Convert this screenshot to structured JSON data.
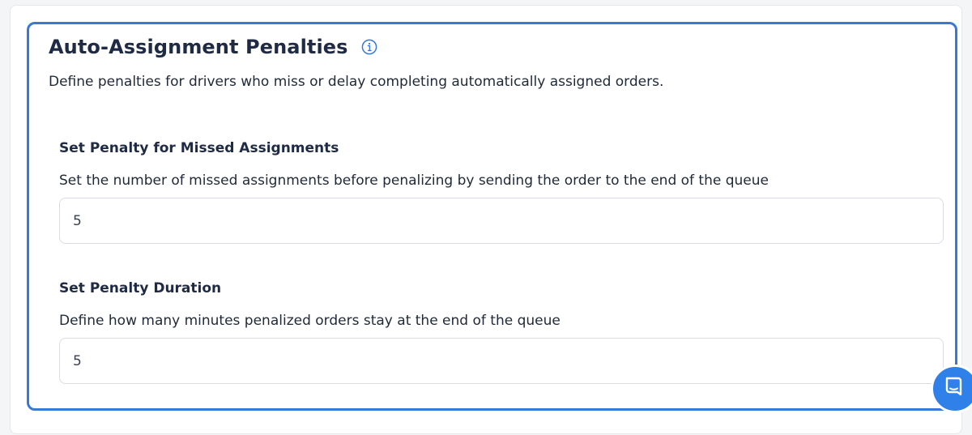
{
  "card": {
    "title": "Auto-Assignment Penalties",
    "description": "Define penalties for drivers who miss or delay completing automatically assigned orders."
  },
  "sections": [
    {
      "title": "Set Penalty for Missed Assignments",
      "description": "Set the number of missed assignments before penalizing by sending the order to the end of the queue",
      "value": "5"
    },
    {
      "title": "Set Penalty Duration",
      "description": "Define how many minutes penalized orders stay at the end of the queue",
      "value": "5"
    }
  ],
  "icons": {
    "info": "info-icon",
    "chat": "chat-icon"
  },
  "colors": {
    "accent": "#3a78d8",
    "chat_button": "#2f80e8",
    "title_text": "#1f2a44"
  }
}
